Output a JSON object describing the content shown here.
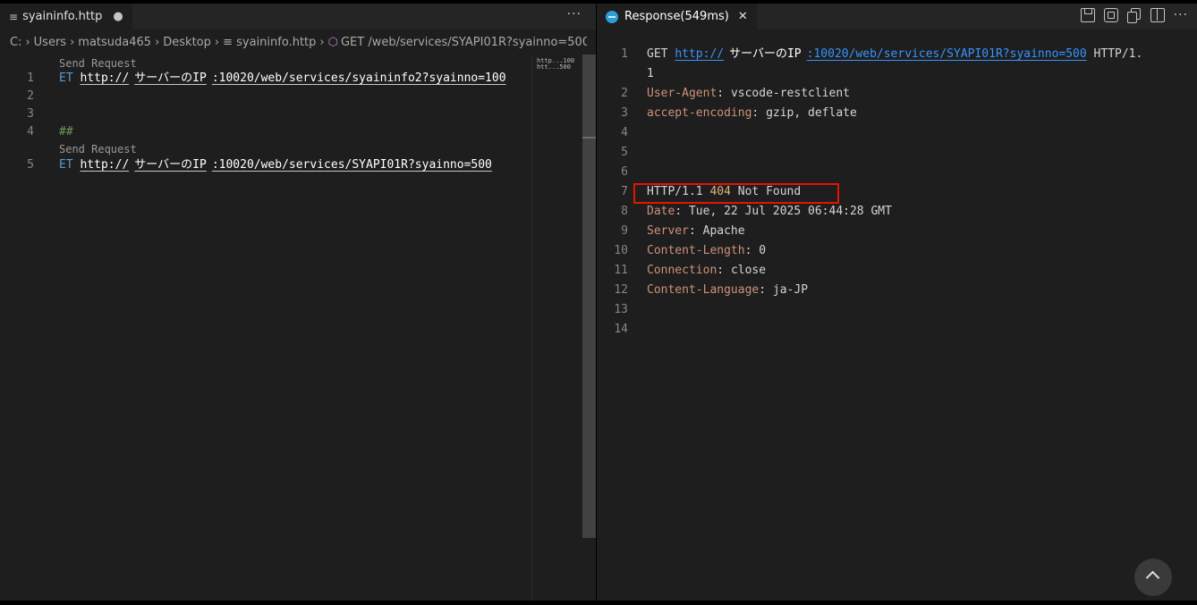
{
  "left_tab": {
    "icon": "≡",
    "filename": "syaininfo.http",
    "dirty_dot": "●"
  },
  "more_actions": "···",
  "breadcrumb": {
    "drive": "C:",
    "sep": "›",
    "users": "Users",
    "user": "matsuda465",
    "desktop": "Desktop",
    "file_icon": "≡",
    "file": "syaininfo.http",
    "request": "GET /web/services/SYAPI01R?syainno=500"
  },
  "editor": {
    "codelens": "Send Request",
    "lines": [
      {
        "no": "1",
        "method": "ET",
        "scheme": "http://",
        "ip": "サーバーのIP",
        "rest": ":10020/web/services/syaininfo2?syainno=100"
      },
      {
        "no": "2"
      },
      {
        "no": "3"
      },
      {
        "no": "4",
        "comment": "##"
      },
      {
        "no": "5",
        "method": "ET",
        "scheme": "http://",
        "ip": "サーバーのIP",
        "rest": ":10020/web/services/SYAPI01R?syainno=500"
      }
    ]
  },
  "minimap": {
    "line1": "http...100",
    "line2": "htt...500"
  },
  "response_tab": {
    "title": "Response(549ms)",
    "close": "✕"
  },
  "response": {
    "line_numbers": [
      "1",
      "",
      "2",
      "3",
      "4",
      "5",
      "6",
      "7",
      "8",
      "9",
      "10",
      "11",
      "12",
      "13",
      "14"
    ],
    "request_line": {
      "method": "GET",
      "scheme": "http://",
      "ip": "サーバーのIP",
      "rest": ":10020/web/services/SYAPI01R?syainno=500",
      "version": "HTTP/1.",
      "wrap": "1"
    },
    "request_headers": [
      {
        "name": "User-Agent",
        "value": "vscode-restclient"
      },
      {
        "name": "accept-encoding",
        "value": "gzip, deflate"
      }
    ],
    "status": {
      "version": "HTTP/1.1",
      "code": "404",
      "text": "Not Found"
    },
    "response_headers": [
      {
        "name": "Date",
        "value": "Tue, 22 Jul 2025 06:44:28 GMT"
      },
      {
        "name": "Server",
        "value": "Apache"
      },
      {
        "name": "Content-Length",
        "value": "0"
      },
      {
        "name": "Connection",
        "value": "close"
      },
      {
        "name": "Content-Language",
        "value": "ja-JP"
      }
    ],
    "colon": ":"
  },
  "colors": {
    "accent_link": "#3794ff",
    "header_name": "#ce9178",
    "status_code": "#dcb67a",
    "highlight_box": "#e51400"
  }
}
